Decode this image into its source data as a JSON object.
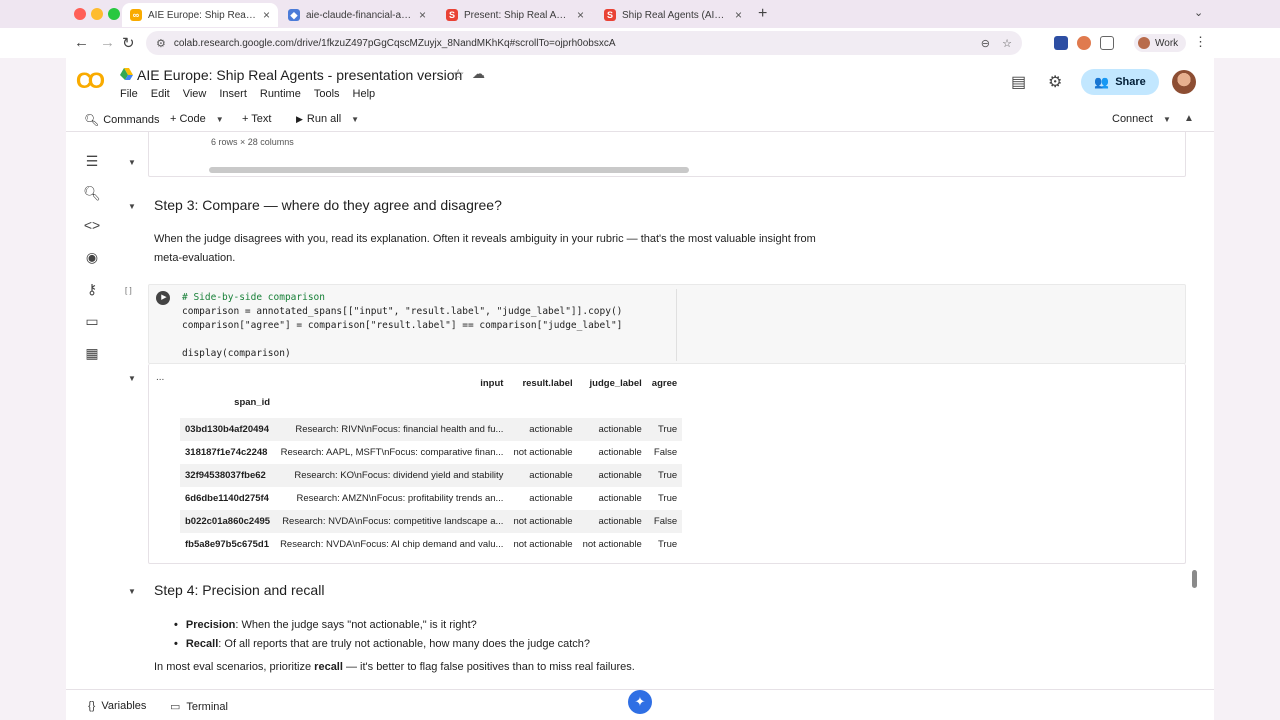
{
  "browser": {
    "tabs": [
      {
        "label": "AIE Europe: Ship Real Agents",
        "icon": "colab-icon",
        "active": true
      },
      {
        "label": "aie-claude-financial-agent - ",
        "icon": "arize-icon",
        "active": false
      },
      {
        "label": "Present: Ship Real Agents (A",
        "icon": "slides-icon",
        "active": false
      },
      {
        "label": "Ship Real Agents (AIE Europe",
        "icon": "slides-icon",
        "active": false
      }
    ],
    "url": "colab.research.google.com/drive/1fkzuZ497pGgCqscMZuyjx_8NandMKhKq#scrollTo=ojprh0obsxcA",
    "profile_label": "Work"
  },
  "notebook": {
    "title": "AIE Europe: Ship Real Agents - presentation version",
    "menus": [
      "File",
      "Edit",
      "View",
      "Insert",
      "Runtime",
      "Tools",
      "Help"
    ],
    "share_label": "Share"
  },
  "toolbar": {
    "commands": "Commands",
    "code": "+ Code",
    "text": "+ Text",
    "run_all": "Run all",
    "connect": "Connect"
  },
  "cells": {
    "prev_output_note": "6 rows × 28 columns",
    "step3_heading": "Step 3: Compare — where do they agree and disagree?",
    "step3_para_line1": "When the judge disagrees with you, read its explanation. Often it reveals ambiguity in your rubric — that's the most valuable insight from",
    "step3_para_line2": "meta-evaluation.",
    "run_bracket": "[ ]",
    "code_lines": [
      "# Side-by-side comparison",
      "comparison = annotated_spans[[\"input\", \"result.label\", \"judge_label\"]].copy()",
      "comparison[\"agree\"] = comparison[\"result.label\"] == comparison[\"judge_label\"]",
      "",
      "display(comparison)"
    ],
    "output_dots": "...",
    "step4_heading": "Step 4: Precision and recall",
    "precision_term": "Precision",
    "precision_text": ": When the judge says \"not actionable,\" is it right?",
    "recall_term": "Recall",
    "recall_text": ": Of all reports that are truly not actionable, how many does the judge catch?",
    "closing_pre": "In most eval scenarios, prioritize ",
    "closing_bold": "recall",
    "closing_post": " — it's better to flag false positives than to miss real failures."
  },
  "table": {
    "columns": [
      "input",
      "result.label",
      "judge_label",
      "agree"
    ],
    "index_name": "span_id",
    "rows": [
      {
        "span_id": "03bd130b4af20494",
        "input": "Research: RIVN\\nFocus: financial health and fu...",
        "result_label": "actionable",
        "judge_label": "actionable",
        "agree": "True"
      },
      {
        "span_id": "318187f1e74c2248",
        "input": "Research: AAPL, MSFT\\nFocus: comparative finan...",
        "result_label": "not actionable",
        "judge_label": "actionable",
        "agree": "False"
      },
      {
        "span_id": "32f94538037fbe62",
        "input": "Research: KO\\nFocus: dividend yield and stability",
        "result_label": "actionable",
        "judge_label": "actionable",
        "agree": "True"
      },
      {
        "span_id": "6d6dbe1140d275f4",
        "input": "Research: AMZN\\nFocus: profitability trends an...",
        "result_label": "actionable",
        "judge_label": "actionable",
        "agree": "True"
      },
      {
        "span_id": "b022c01a860c2495",
        "input": "Research: NVDA\\nFocus: competitive landscape a...",
        "result_label": "not actionable",
        "judge_label": "actionable",
        "agree": "False"
      },
      {
        "span_id": "fb5a8e97b5c675d1",
        "input": "Research: NVDA\\nFocus: AI chip demand and valu...",
        "result_label": "not actionable",
        "judge_label": "not actionable",
        "agree": "True"
      }
    ]
  },
  "bottom": {
    "variables": "Variables",
    "terminal": "Terminal"
  },
  "colors": {
    "share_bg": "#c2e7ff",
    "chrome_bg": "#efe6f1",
    "logo": "#f9ab00"
  }
}
